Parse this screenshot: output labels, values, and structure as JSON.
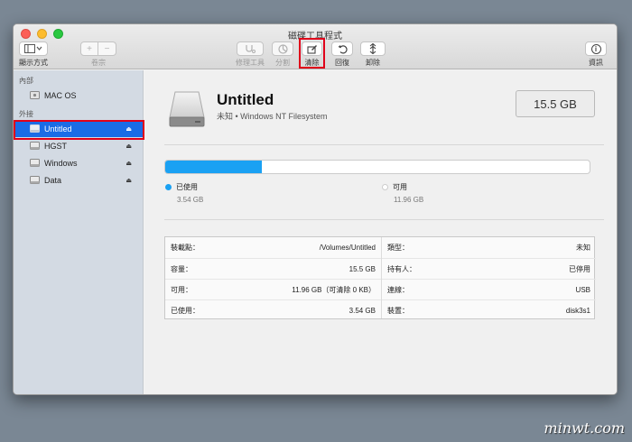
{
  "window": {
    "title": "磁碟工具程式"
  },
  "toolbar": {
    "view": {
      "label": "顯示方式"
    },
    "volume": {
      "label": "卷宗",
      "add": "+",
      "remove": "−"
    },
    "repair": {
      "label": "修理工具"
    },
    "partition": {
      "label": "分割"
    },
    "erase": {
      "label": "清除"
    },
    "restore": {
      "label": "回復"
    },
    "unmount": {
      "label": "卸除"
    },
    "info": {
      "label": "資訊",
      "glyph": "i"
    }
  },
  "sidebar": {
    "internal_header": "內部",
    "external_header": "外接",
    "internal_items": [
      {
        "label": "MAC OS"
      }
    ],
    "external_items": [
      {
        "label": "Untitled",
        "eject": "⏏"
      },
      {
        "label": "HGST",
        "eject": "⏏"
      },
      {
        "label": "Windows",
        "eject": "⏏"
      },
      {
        "label": "Data",
        "eject": "⏏"
      }
    ]
  },
  "volume": {
    "name": "Untitled",
    "subtitle": "未知 • Windows NT Filesystem",
    "size": "15.5 GB",
    "used_fraction": 0.228
  },
  "usage": {
    "used": {
      "label": "已使用",
      "value": "3.54 GB",
      "color": "#1aa1f3"
    },
    "free": {
      "label": "可用",
      "value": "11.96 GB",
      "color": "#ffffff"
    }
  },
  "info_table": {
    "left": [
      {
        "key": "裝載點：",
        "value": "/Volumes/Untitled"
      },
      {
        "key": "容量：",
        "value": "15.5 GB"
      },
      {
        "key": "可用：",
        "value": "11.96 GB（可清除 0 KB）"
      },
      {
        "key": "已使用：",
        "value": "3.54 GB"
      }
    ],
    "right": [
      {
        "key": "類型：",
        "value": "未知"
      },
      {
        "key": "持有人：",
        "value": "已停用"
      },
      {
        "key": "連線：",
        "value": "USB"
      },
      {
        "key": "裝置：",
        "value": "disk3s1"
      }
    ]
  },
  "watermark": "minwt.com",
  "colors": {
    "accent": "#1a6ce6",
    "highlight": "#e0001a"
  }
}
